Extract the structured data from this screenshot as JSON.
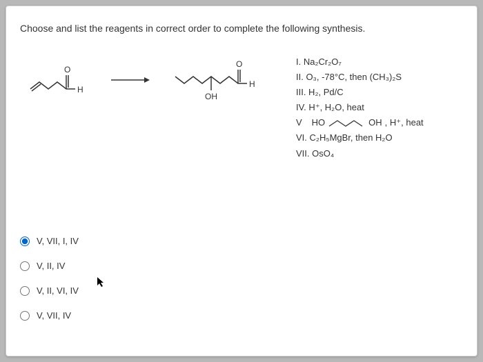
{
  "question": "Choose and list the reagents in correct order to complete the following synthesis.",
  "molecules": {
    "start_label_H": "H",
    "start_label_O": "O",
    "product_label_H": "H",
    "product_label_O": "O",
    "product_label_OH": "OH"
  },
  "arrow": "→",
  "reagents": {
    "I": "I. Na₂Cr₂O₇",
    "II": "II. O₃, -78°C, then (CH₃)₂S",
    "III": "III. H₂, Pd/C",
    "IV": "IV. H⁺, H₂O, heat",
    "V_prefix": "V",
    "V_ho": "HO",
    "V_oh": "OH",
    "V_suffix": ", H⁺, heat",
    "VI": "VI. C₂H₅MgBr, then H₂O",
    "VII": "VII. OsO₄"
  },
  "options": [
    {
      "label": "V, VII, I, IV",
      "selected": true
    },
    {
      "label": "V, II, IV",
      "selected": false
    },
    {
      "label": "V, II, VI, IV",
      "selected": false
    },
    {
      "label": "V, VII, IV",
      "selected": false
    }
  ]
}
